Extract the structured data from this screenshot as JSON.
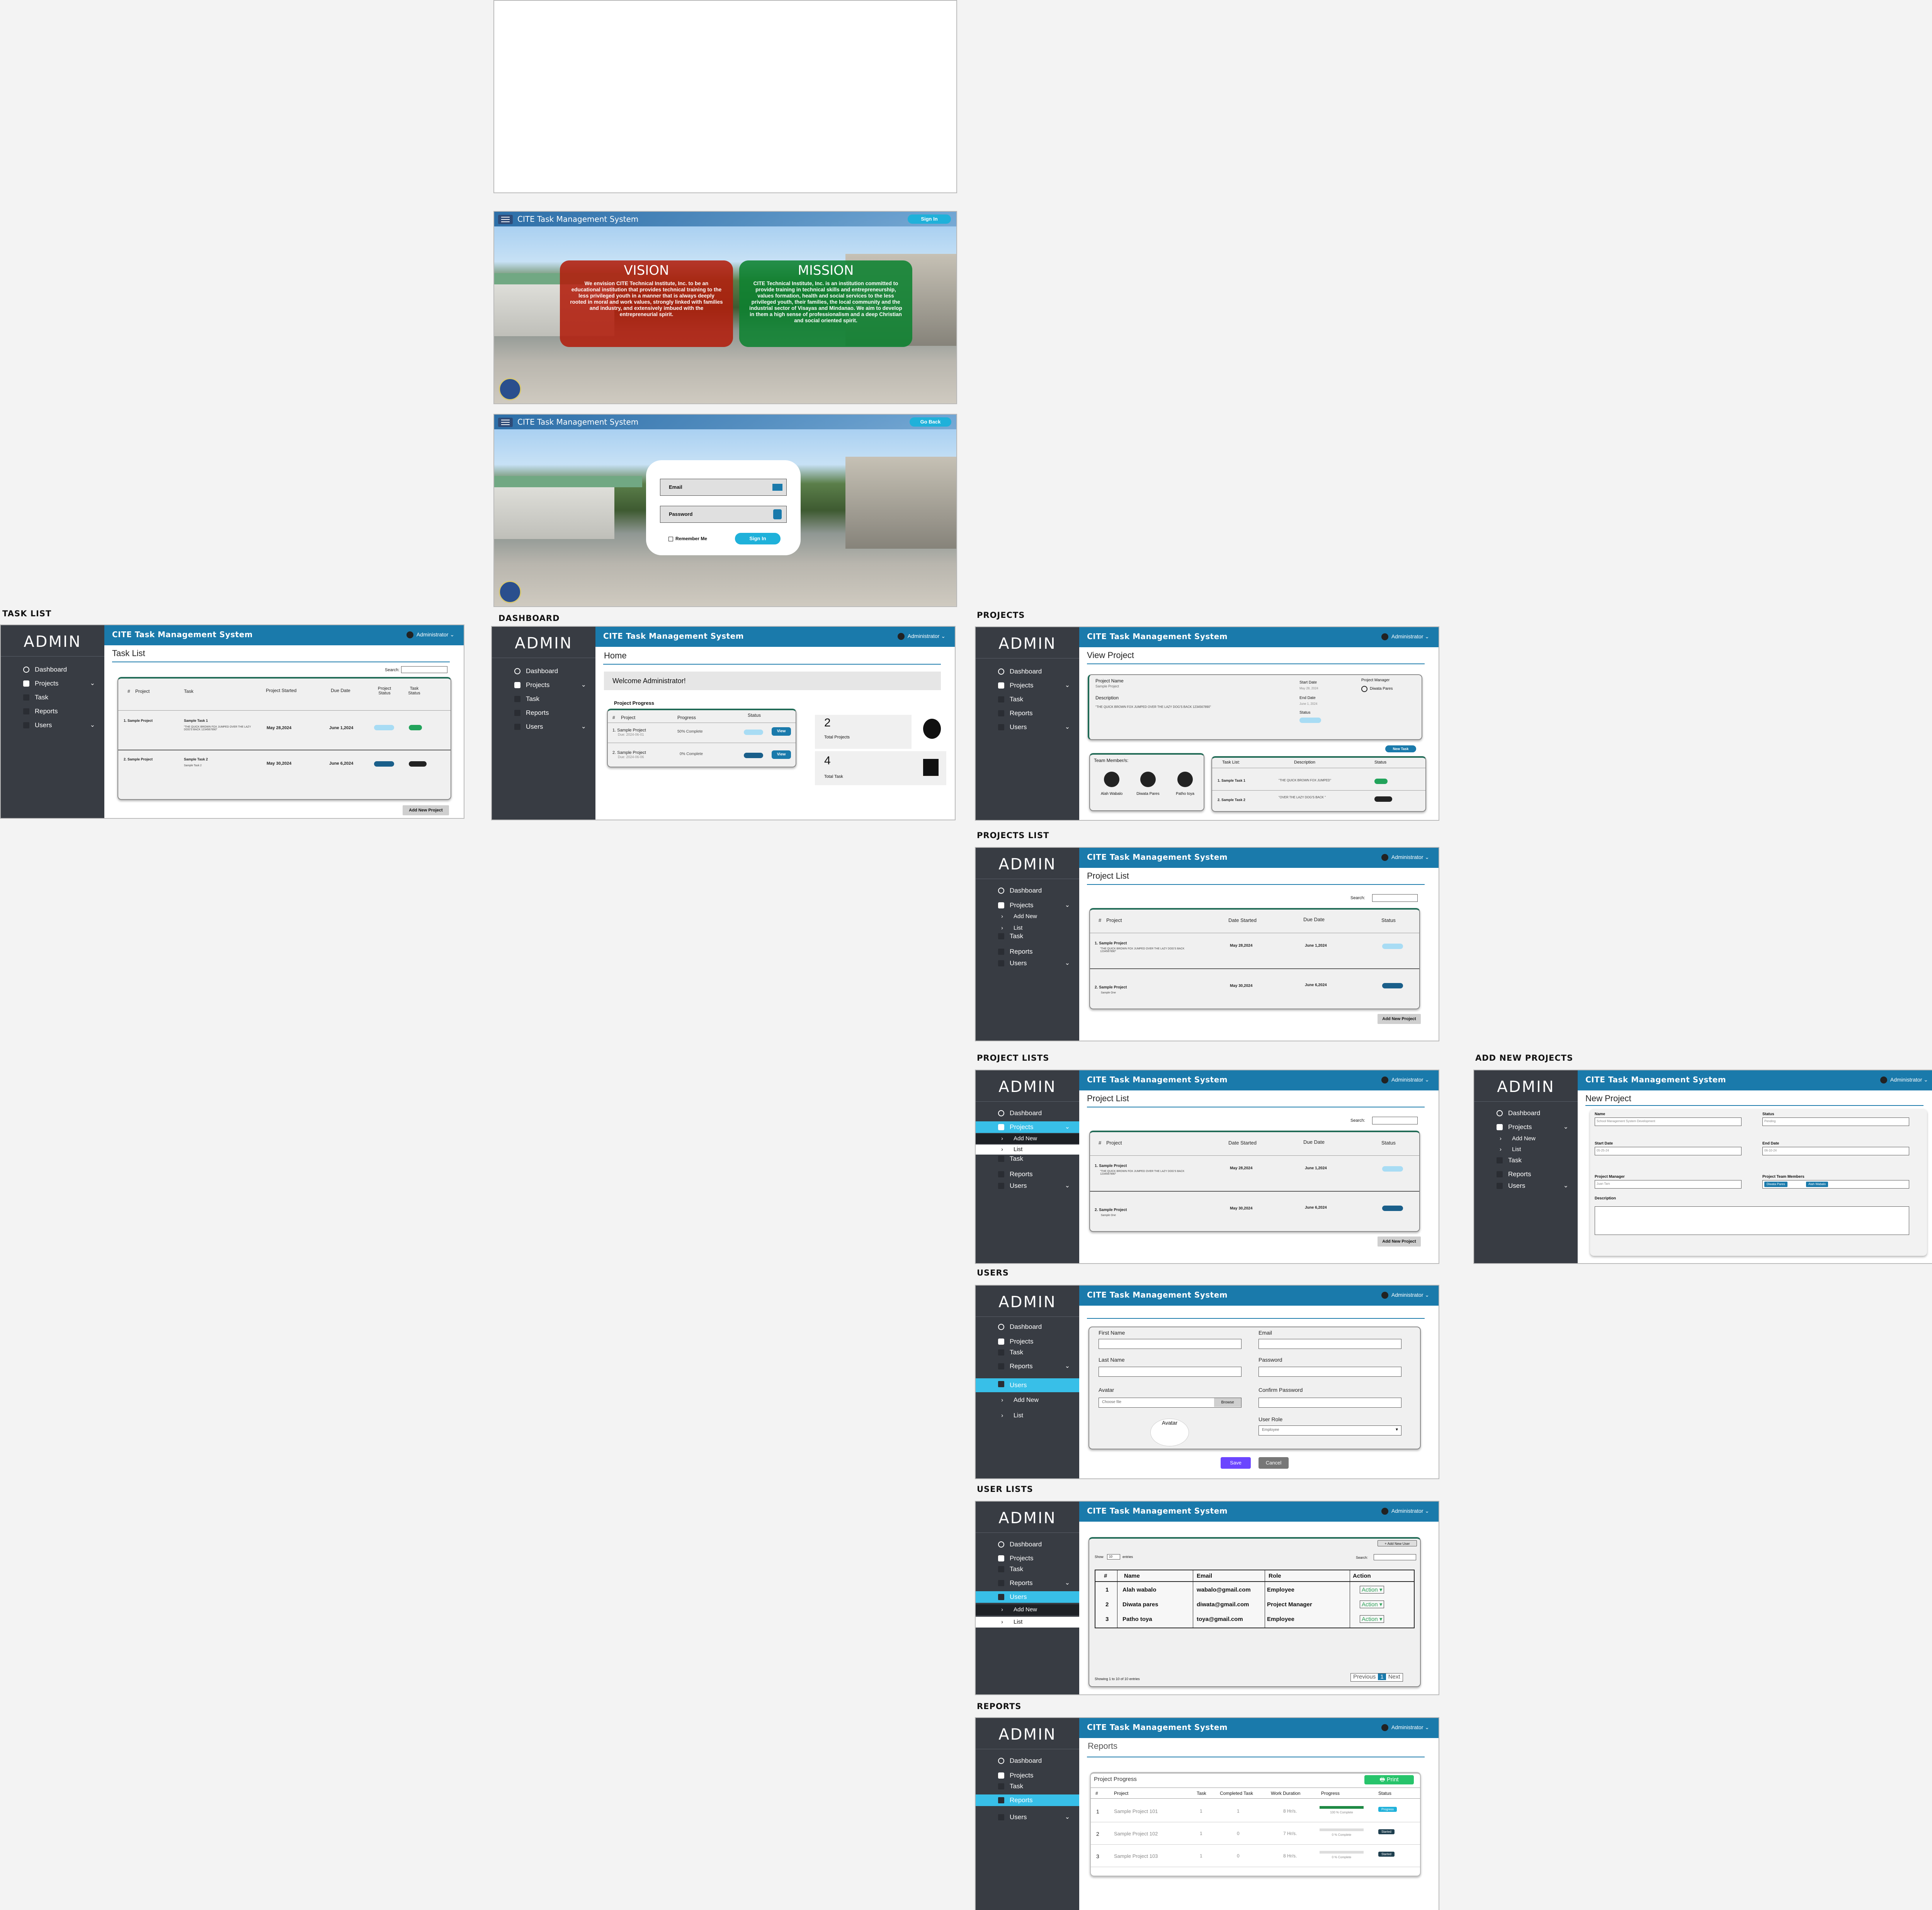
{
  "labels": {
    "task_list": "TASK LIST",
    "dashboard": "DASHBOARD",
    "projects": "PROJECTS",
    "projects_list": "PROJECTS LIST",
    "project_lists": "PROJECT LISTS",
    "add_new_projects": "ADD NEW PROJECTS",
    "users": "USERS",
    "user_lists": "USER LISTS",
    "reports": "REPORTS"
  },
  "app": {
    "title": "CITE Task Management System",
    "brand": "ADMIN",
    "user": "Administrator",
    "colors": {
      "header": "#1a7aab",
      "sidebar": "#383c43",
      "active": "#38bfe8",
      "accent": "#1f6a55"
    }
  },
  "nav": {
    "dashboard": "Dashboard",
    "projects": "Projects",
    "task": "Task",
    "reports": "Reports",
    "users": "Users",
    "add_new": "Add New",
    "list": "List"
  },
  "landing": {
    "sign_in": "Sign In",
    "vision_title": "VISION",
    "vision_text": "We envision CITE Technical Institute, Inc. to be an educational institution that provides technical training to the less privileged youth in a manner that is always deeply rooted in moral and work values, strongly linked with families and industry, and extensively imbued with the entrepreneurial spirit.",
    "mission_title": "MISSION",
    "mission_text": "CITE Technical Institute, Inc. is an institution committed to provide training in technical skills and entrepreneurship, values formation, health and social services to the less privileged youth, their families, the local community and the industrial sector of Visayas and Mindanao. We aim to develop in them a high sense of professionalism and a deep Christian and social oriented spirit."
  },
  "login": {
    "go_back": "Go Back",
    "email": "Email",
    "password": "Password",
    "remember": "Remember Me",
    "sign_in": "Sign In"
  },
  "task_list": {
    "heading": "Task List",
    "search": "Search:",
    "headers": [
      "#",
      "Project",
      "Task",
      "Project Started",
      "Due Date",
      "Project Status",
      "Task Status"
    ],
    "rows": [
      {
        "project": "1. Sample Project",
        "task": "Sample Task 1",
        "desc": "\"THE QUICK BROWN FOX JUMPED OVER THE LAZY DOG'S BACK 1234567890\"",
        "started": "May 28,2024",
        "due": "June 1,2024"
      },
      {
        "project": "2. Sample Project",
        "task": "Sample Task 2",
        "desc": "Sample Task 2",
        "started": "May 30,2024",
        "due": "June 6,2024"
      }
    ],
    "add_button": "Add New Project"
  },
  "dashboard": {
    "heading": "Home",
    "welcome": "Welcome Administrator!",
    "progress_title": "Project Progress",
    "headers": [
      "#",
      "Project",
      "Progress",
      "Status"
    ],
    "rows": [
      {
        "project": "1. Sample Project",
        "due": "Due: 2024-06-01",
        "progress": "50% Complete",
        "view": "View"
      },
      {
        "project": "2. Sample Project",
        "due": "Due: 2024-06-06",
        "progress": "0% Complete",
        "view": "View"
      }
    ],
    "total_projects_value": "2",
    "total_projects_label": "Total Projects",
    "total_task_value": "4",
    "total_task_label": "Total Task"
  },
  "view_project": {
    "heading": "View Project",
    "project_name_label": "Project Name",
    "project_name": "Sample Project",
    "description_label": "Description",
    "description": "\"THE QUICK BROWN FOX JUMPED OVER THE LAZY DOG'S BACK 1234567890\"",
    "start_date_label": "Start Date",
    "start_date": "May 28, 2024",
    "end_date_label": "End Date",
    "end_date": "June 1, 2024",
    "status_label": "Status",
    "pm_label": "Project Manager",
    "pm_name": "Diwata Pares",
    "new_task": "New Task",
    "team_label": "Team Member/s:",
    "members": [
      "Alah Wabalo",
      "Diwata Pares",
      "Patho toya"
    ],
    "task_headers": [
      "Task List:",
      "Description",
      "Status"
    ],
    "tasks": [
      {
        "name": "1. Sample Task 1",
        "desc": "\"THE QUICK BROWN FOX JUMPED\""
      },
      {
        "name": "2. Sample Task 2",
        "desc": "\"OVER THE LAZY DOG'S BACK \""
      }
    ]
  },
  "project_list": {
    "heading": "Project List",
    "search": "Search:",
    "headers": [
      "#",
      "Project",
      "Date Started",
      "Due Date",
      "Status"
    ],
    "rows": [
      {
        "project": "1. Sample Project",
        "desc": "\"THE QUICK BROWN FOX JUMPED OVER THE LAZY DOG'S BACK 1234567890\"",
        "started": "May 28,2024",
        "due": "June 1,2024"
      },
      {
        "project": "2. Sample Project",
        "desc": "Sample One",
        "started": "May 30,2024",
        "due": "June 6,2024"
      }
    ],
    "add_button": "Add New Project"
  },
  "new_project": {
    "heading": "New Project",
    "name_label": "Name",
    "name_value": "School Management System Development",
    "status_label": "Status",
    "status_value": "Pending",
    "start_label": "Start Date",
    "start_value": "05-25-24",
    "end_label": "End Date",
    "end_value": "06-10-24",
    "pm_label": "Project Manager",
    "pm_value": "Juan Tam",
    "team_label": "Project Team Members",
    "team_values": [
      "Diwata Pares",
      "Alah Wabalo"
    ],
    "desc_label": "Description"
  },
  "users_form": {
    "first_name": "First Name",
    "last_name": "Last Name",
    "avatar": "Avatar",
    "choose_file": "Choose file",
    "browse": "Browse",
    "avatar_preview": "Avatar",
    "email": "Email",
    "password": "Password",
    "confirm_password": "Confirm Password",
    "user_role": "User Role",
    "role_value": "Employee",
    "save": "Save",
    "cancel": "Cancel"
  },
  "user_list": {
    "add_user": "+ Add New User",
    "show": "Show",
    "entries_value": "10",
    "entries": "entries",
    "search": "Search:",
    "headers": [
      "#",
      "Name",
      "Email",
      "Role",
      "Action"
    ],
    "rows": [
      {
        "n": "1",
        "name": "Alah wabalo",
        "email": "wabalo@gmail.com",
        "role": "Employee",
        "action": "Action"
      },
      {
        "n": "2",
        "name": "Diwata pares",
        "email": "diwata@gmail.com",
        "role": "Project Manager",
        "action": "Action"
      },
      {
        "n": "3",
        "name": "Patho toya",
        "email": "toya@gmail.com",
        "role": "Employee",
        "action": "Action"
      }
    ],
    "showing": "Showing 1 to 10 of 10 entries",
    "previous": "Previous",
    "page": "1",
    "next": "Next"
  },
  "reports": {
    "heading": "Reports",
    "progress_title": "Project Progress",
    "print": "Print",
    "headers": [
      "#",
      "Project",
      "Task",
      "Completed Task",
      "Work Duration",
      "Progress",
      "Status"
    ],
    "rows": [
      {
        "n": "1",
        "project": "Sample Project 101",
        "task": "1",
        "done": "1",
        "dur": "8 Hr/s.",
        "progress": "100 % Complete",
        "status": "Progress",
        "fill": 1.0
      },
      {
        "n": "2",
        "project": "Sample Project 102",
        "task": "1",
        "done": "0",
        "dur": "7 Hr/s.",
        "progress": "0 % Complete",
        "status": "Started",
        "fill": 0
      },
      {
        "n": "3",
        "project": "Sample Project 103",
        "task": "1",
        "done": "0",
        "dur": "8 Hr/s.",
        "progress": "0 % Complete",
        "status": "Started",
        "fill": 0
      }
    ]
  }
}
